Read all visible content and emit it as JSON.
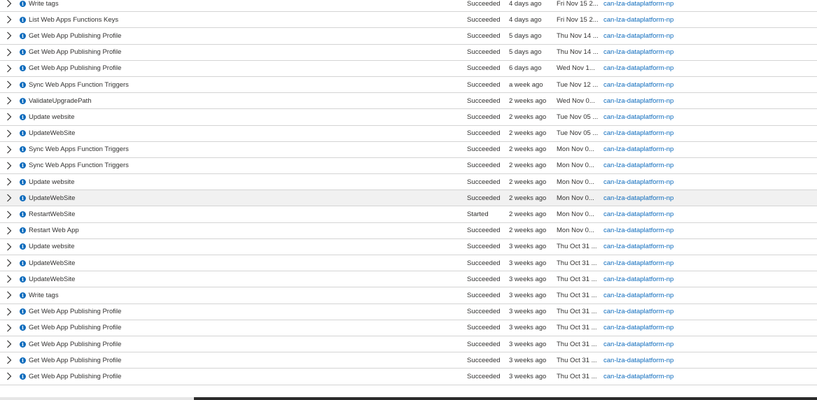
{
  "rows": [
    {
      "operation": "Write tags",
      "status": "Succeeded",
      "time": "4 days ago",
      "timestamp": "Fri Nov 15 2...",
      "subscription": "can-lza-dataplatform-np"
    },
    {
      "operation": "List Web Apps Functions Keys",
      "status": "Succeeded",
      "time": "4 days ago",
      "timestamp": "Fri Nov 15 2...",
      "subscription": "can-lza-dataplatform-np"
    },
    {
      "operation": "Get Web App Publishing Profile",
      "status": "Succeeded",
      "time": "5 days ago",
      "timestamp": "Thu Nov 14 ...",
      "subscription": "can-lza-dataplatform-np"
    },
    {
      "operation": "Get Web App Publishing Profile",
      "status": "Succeeded",
      "time": "5 days ago",
      "timestamp": "Thu Nov 14 ...",
      "subscription": "can-lza-dataplatform-np"
    },
    {
      "operation": "Get Web App Publishing Profile",
      "status": "Succeeded",
      "time": "6 days ago",
      "timestamp": "Wed Nov 1...",
      "subscription": "can-lza-dataplatform-np"
    },
    {
      "operation": "Sync Web Apps Function Triggers",
      "status": "Succeeded",
      "time": "a week ago",
      "timestamp": "Tue Nov 12 ...",
      "subscription": "can-lza-dataplatform-np"
    },
    {
      "operation": "ValidateUpgradePath",
      "status": "Succeeded",
      "time": "2 weeks ago",
      "timestamp": "Wed Nov 0...",
      "subscription": "can-lza-dataplatform-np"
    },
    {
      "operation": "Update website",
      "status": "Succeeded",
      "time": "2 weeks ago",
      "timestamp": "Tue Nov 05 ...",
      "subscription": "can-lza-dataplatform-np"
    },
    {
      "operation": "UpdateWebSite",
      "status": "Succeeded",
      "time": "2 weeks ago",
      "timestamp": "Tue Nov 05 ...",
      "subscription": "can-lza-dataplatform-np"
    },
    {
      "operation": "Sync Web Apps Function Triggers",
      "status": "Succeeded",
      "time": "2 weeks ago",
      "timestamp": "Mon Nov 0...",
      "subscription": "can-lza-dataplatform-np"
    },
    {
      "operation": "Sync Web Apps Function Triggers",
      "status": "Succeeded",
      "time": "2 weeks ago",
      "timestamp": "Mon Nov 0...",
      "subscription": "can-lza-dataplatform-np"
    },
    {
      "operation": "Update website",
      "status": "Succeeded",
      "time": "2 weeks ago",
      "timestamp": "Mon Nov 0...",
      "subscription": "can-lza-dataplatform-np"
    },
    {
      "operation": "UpdateWebSite",
      "status": "Succeeded",
      "time": "2 weeks ago",
      "timestamp": "Mon Nov 0...",
      "subscription": "can-lza-dataplatform-np",
      "highlighted": true
    },
    {
      "operation": "RestartWebSite",
      "status": "Started",
      "time": "2 weeks ago",
      "timestamp": "Mon Nov 0...",
      "subscription": "can-lza-dataplatform-np"
    },
    {
      "operation": "Restart Web App",
      "status": "Succeeded",
      "time": "2 weeks ago",
      "timestamp": "Mon Nov 0...",
      "subscription": "can-lza-dataplatform-np"
    },
    {
      "operation": "Update website",
      "status": "Succeeded",
      "time": "3 weeks ago",
      "timestamp": "Thu Oct 31 ...",
      "subscription": "can-lza-dataplatform-np"
    },
    {
      "operation": "UpdateWebSite",
      "status": "Succeeded",
      "time": "3 weeks ago",
      "timestamp": "Thu Oct 31 ...",
      "subscription": "can-lza-dataplatform-np"
    },
    {
      "operation": "UpdateWebSite",
      "status": "Succeeded",
      "time": "3 weeks ago",
      "timestamp": "Thu Oct 31 ...",
      "subscription": "can-lza-dataplatform-np"
    },
    {
      "operation": "Write tags",
      "status": "Succeeded",
      "time": "3 weeks ago",
      "timestamp": "Thu Oct 31 ...",
      "subscription": "can-lza-dataplatform-np"
    },
    {
      "operation": "Get Web App Publishing Profile",
      "status": "Succeeded",
      "time": "3 weeks ago",
      "timestamp": "Thu Oct 31 ...",
      "subscription": "can-lza-dataplatform-np"
    },
    {
      "operation": "Get Web App Publishing Profile",
      "status": "Succeeded",
      "time": "3 weeks ago",
      "timestamp": "Thu Oct 31 ...",
      "subscription": "can-lza-dataplatform-np"
    },
    {
      "operation": "Get Web App Publishing Profile",
      "status": "Succeeded",
      "time": "3 weeks ago",
      "timestamp": "Thu Oct 31 ...",
      "subscription": "can-lza-dataplatform-np"
    },
    {
      "operation": "Get Web App Publishing Profile",
      "status": "Succeeded",
      "time": "3 weeks ago",
      "timestamp": "Thu Oct 31 ...",
      "subscription": "can-lza-dataplatform-np"
    },
    {
      "operation": "Get Web App Publishing Profile",
      "status": "Succeeded",
      "time": "3 weeks ago",
      "timestamp": "Thu Oct 31 ...",
      "subscription": "can-lza-dataplatform-np"
    }
  ],
  "icons": {
    "expand": "chevron-right-icon",
    "level": "info-icon"
  },
  "colors": {
    "link": "#0f6cbd",
    "info": "#0f6cbd",
    "highlight_row": "#f1f1f1"
  }
}
